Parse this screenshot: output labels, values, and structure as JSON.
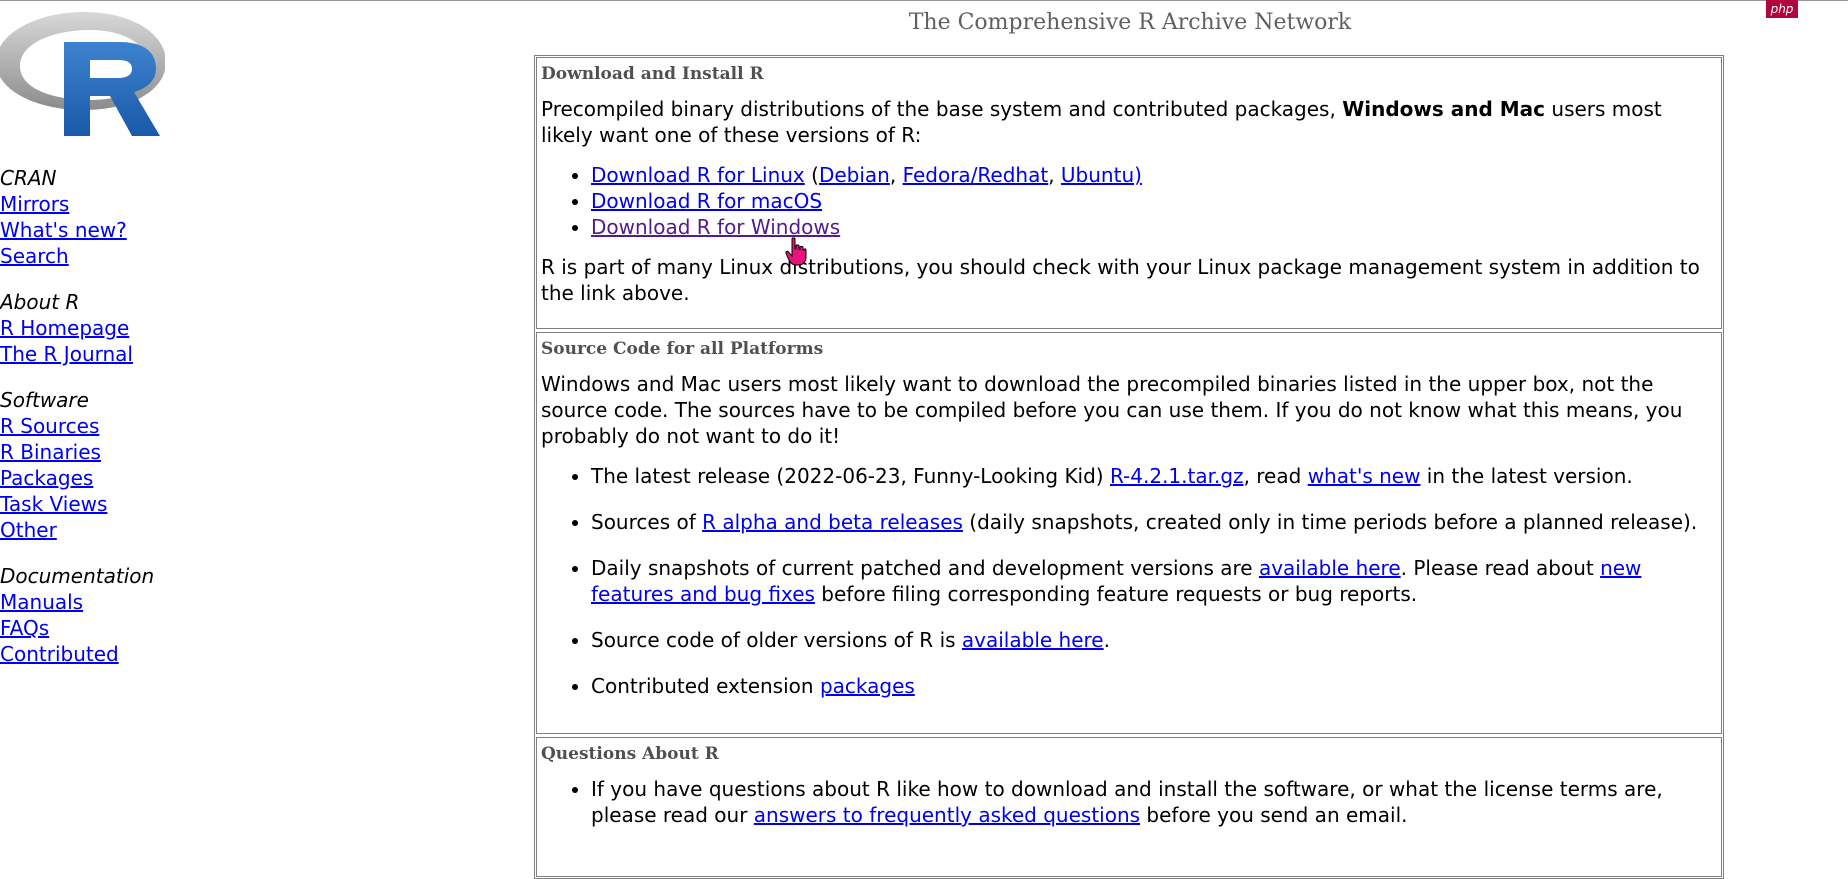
{
  "page_title": "The Comprehensive R Archive Network",
  "badge": "php",
  "logo": {
    "letter": "R",
    "ring_color": "#999999",
    "letter_color": "#1f65b7"
  },
  "sidebar": {
    "sections": [
      {
        "heading": "CRAN",
        "links": [
          "Mirrors",
          "What's new?",
          "Search"
        ]
      },
      {
        "heading": "About R",
        "links": [
          "R Homepage",
          "The R Journal"
        ]
      },
      {
        "heading": "Software",
        "links": [
          "R Sources",
          "R Binaries",
          "Packages",
          "Task Views",
          "Other"
        ]
      },
      {
        "heading": "Documentation",
        "links": [
          "Manuals",
          "FAQs",
          "Contributed"
        ]
      }
    ]
  },
  "download": {
    "heading": "Download and Install R",
    "intro_before": "Precompiled binary distributions of the base system and contributed packages, ",
    "intro_bold": "Windows and Mac",
    "intro_after": " users most likely want one of these versions of R:",
    "linux_link": "Download R for Linux",
    "linux_open": " (",
    "debian": "Debian",
    "comma1": ", ",
    "fedora": "Fedora/Redhat",
    "comma2": ", ",
    "ubuntu": "Ubuntu)",
    "macos_link": "Download R for macOS",
    "windows_link": "Download R for Windows",
    "note": "R is part of many Linux distributions, you should check with your Linux package management system in addition to the link above."
  },
  "source": {
    "heading": "Source Code for all Platforms",
    "intro": "Windows and Mac users most likely want to download the precompiled binaries listed in the upper box, not the source code. The sources have to be compiled before you can use them. If you do not know what this means, you probably do not want to do it!",
    "latest_before": "The latest release (2022-06-23, Funny-Looking Kid) ",
    "latest_link": "R-4.2.1.tar.gz",
    "latest_mid": ", read ",
    "whatsnew_link": "what's new",
    "latest_after": " in the latest version.",
    "alpha_before": "Sources of ",
    "alpha_link": "R alpha and beta releases",
    "alpha_after": " (daily snapshots, created only in time periods before a planned release).",
    "daily_before": "Daily snapshots of current patched and development versions are ",
    "daily_link": "available here",
    "daily_mid": ". Please read about ",
    "daily_link2": "new features and bug fixes",
    "daily_after": " before filing corresponding feature requests or bug reports.",
    "older_before": "Source code of older versions of R is ",
    "older_link": "available here",
    "older_after": ".",
    "contrib_before": "Contributed extension ",
    "contrib_link": "packages"
  },
  "questions": {
    "heading": "Questions About R",
    "text_before": "If you have questions about R like how to download and install the software, or what the license terms are, please read our ",
    "faq_link": "answers to frequently asked questions",
    "text_after": " before you send an email."
  }
}
